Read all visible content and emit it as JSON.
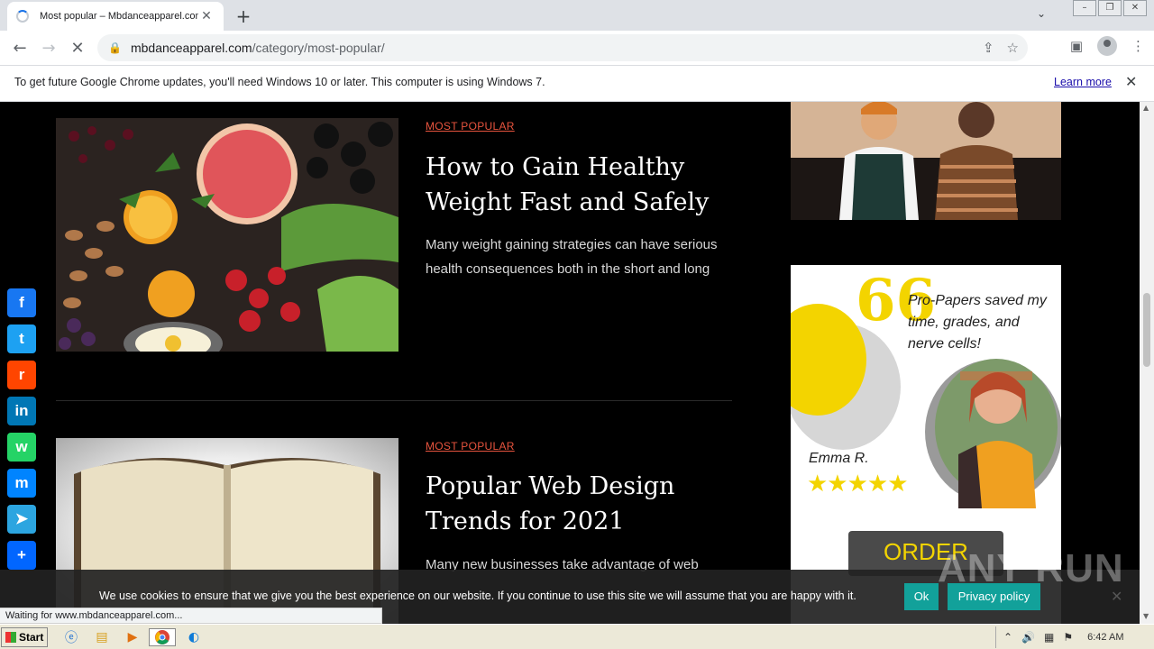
{
  "browser": {
    "tab_title": "Most popular – Mbdanceapparel.com",
    "url_host": "mbdanceapparel.com",
    "url_path": "/category/most-popular/",
    "infobar_message": "To get future Google Chrome updates, you'll need Windows 10 or later. This computer is using Windows 7.",
    "infobar_link": "Learn more",
    "status_text": "Waiting for www.mbdanceapparel.com..."
  },
  "posts": [
    {
      "category": "MOST POPULAR",
      "title": "How to Gain Healthy Weight Fast and Safely",
      "excerpt": "Many weight gaining strategies can have serious health consequences both in the short and long"
    },
    {
      "category": "MOST POPULAR",
      "title": "Popular Web Design Trends for 2021",
      "excerpt": "Many new businesses take advantage of web"
    }
  ],
  "ad": {
    "quote_mark": "66",
    "testimonial": "Pro-Papers saved my time, grades, and nerve cells!",
    "name": "Emma R.",
    "stars": "★★★★★",
    "button": "ORDER"
  },
  "share_buttons": [
    {
      "name": "facebook",
      "glyph": "f",
      "color": "#1877f2"
    },
    {
      "name": "twitter",
      "glyph": "t",
      "color": "#1da1f2"
    },
    {
      "name": "reddit",
      "glyph": "r",
      "color": "#ff4500"
    },
    {
      "name": "linkedin",
      "glyph": "in",
      "color": "#0077b5"
    },
    {
      "name": "whatsapp",
      "glyph": "w",
      "color": "#25d366"
    },
    {
      "name": "messenger",
      "glyph": "m",
      "color": "#0084ff"
    },
    {
      "name": "telegram",
      "glyph": "➤",
      "color": "#2ca5e0"
    },
    {
      "name": "share",
      "glyph": "+",
      "color": "#0166ff"
    }
  ],
  "cookie": {
    "text": "We use cookies to ensure that we give you the best experience on our website. If you continue to use this site we will assume that you are happy with it.",
    "ok": "Ok",
    "privacy": "Privacy policy"
  },
  "watermark": "ANY RUN",
  "taskbar": {
    "start": "Start",
    "clock": "6:42 AM"
  }
}
